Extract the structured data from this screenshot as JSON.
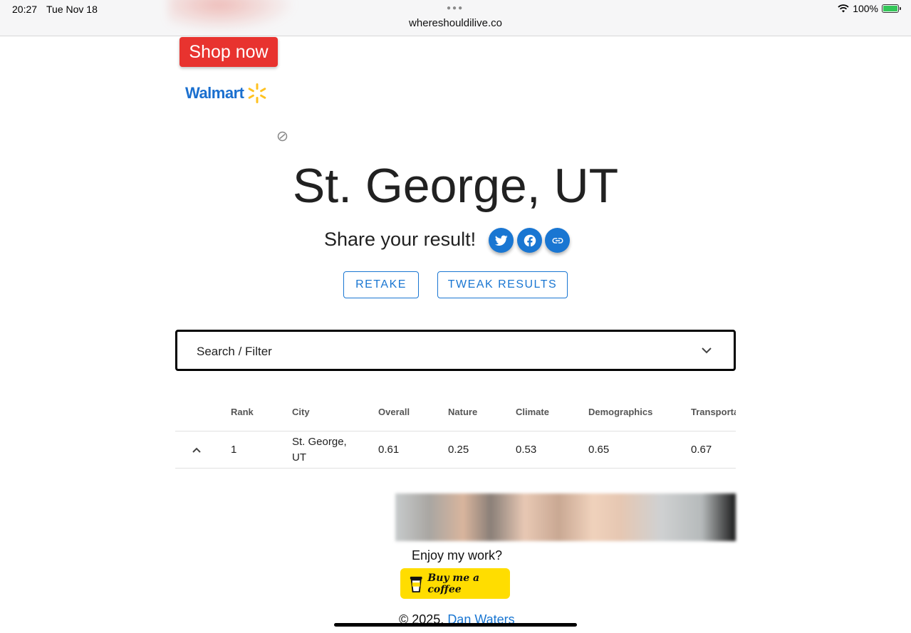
{
  "status_bar": {
    "time": "20:27",
    "date": "Tue Nov 18",
    "url": "whereshouldilive.co",
    "battery": "100%"
  },
  "ad": {
    "shop_label": "Shop now",
    "brand": "Walmart",
    "shop_color": "#e8332f"
  },
  "result": {
    "city": "St. George, UT",
    "share_label": "Share your result!"
  },
  "share_icons": [
    "twitter-icon",
    "facebook-icon",
    "link-icon"
  ],
  "buttons": {
    "retake": "RETAKE",
    "tweak": "TWEAK RESULTS"
  },
  "search": {
    "label": "Search / Filter"
  },
  "table": {
    "headers": [
      "Rank",
      "City",
      "Overall",
      "Nature",
      "Climate",
      "Demographics",
      "Transportation"
    ],
    "rows": [
      {
        "rank": "1",
        "city_line1": "St. George,",
        "city_line2": "UT",
        "overall": "0.61",
        "nature": "0.25",
        "climate": "0.53",
        "demographics": "0.65",
        "transportation": "0.67"
      }
    ]
  },
  "footer": {
    "enjoy": "Enjoy my work?",
    "coffee": "Buy me a coffee",
    "copyright": "© 2025, ",
    "author": "Dan Waters"
  },
  "colors": {
    "accent": "#1976d2",
    "coffee": "#ffdd00"
  }
}
